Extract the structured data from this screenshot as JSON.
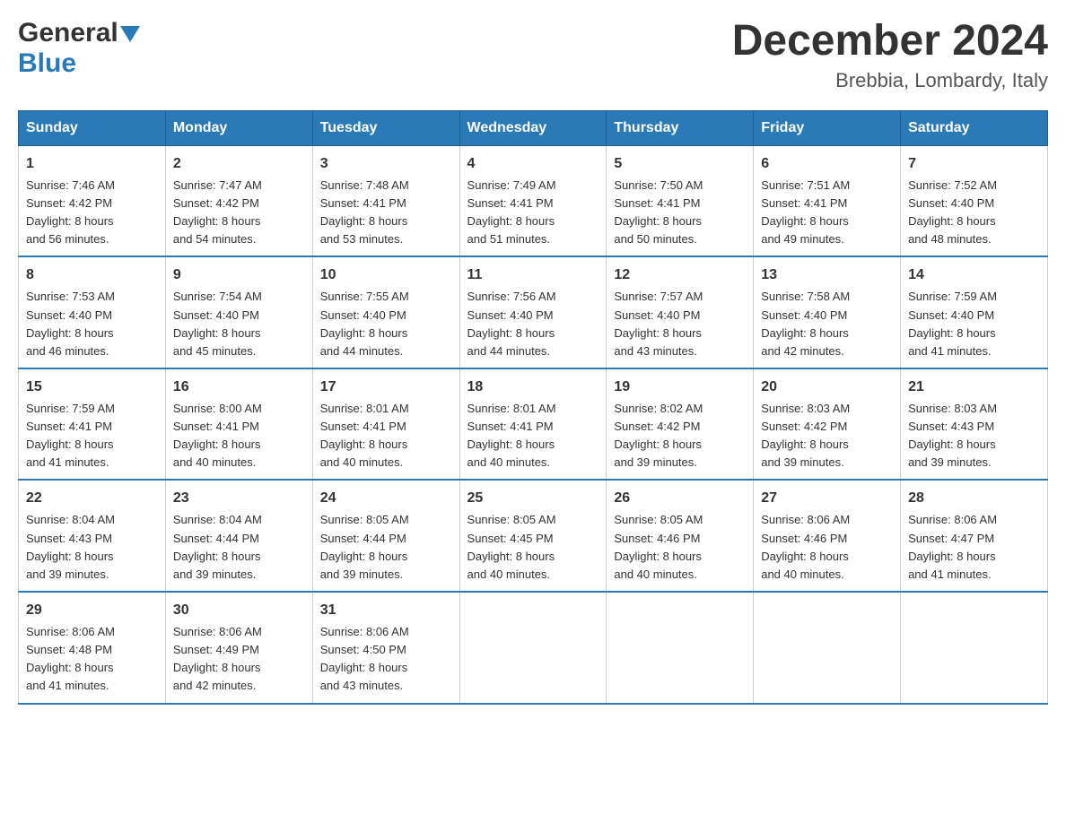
{
  "logo": {
    "general": "General",
    "blue": "Blue",
    "triangle": "▼"
  },
  "title": {
    "month_year": "December 2024",
    "location": "Brebbia, Lombardy, Italy"
  },
  "headers": [
    "Sunday",
    "Monday",
    "Tuesday",
    "Wednesday",
    "Thursday",
    "Friday",
    "Saturday"
  ],
  "weeks": [
    [
      {
        "day": "1",
        "sunrise": "7:46 AM",
        "sunset": "4:42 PM",
        "daylight": "8 hours and 56 minutes."
      },
      {
        "day": "2",
        "sunrise": "7:47 AM",
        "sunset": "4:42 PM",
        "daylight": "8 hours and 54 minutes."
      },
      {
        "day": "3",
        "sunrise": "7:48 AM",
        "sunset": "4:41 PM",
        "daylight": "8 hours and 53 minutes."
      },
      {
        "day": "4",
        "sunrise": "7:49 AM",
        "sunset": "4:41 PM",
        "daylight": "8 hours and 51 minutes."
      },
      {
        "day": "5",
        "sunrise": "7:50 AM",
        "sunset": "4:41 PM",
        "daylight": "8 hours and 50 minutes."
      },
      {
        "day": "6",
        "sunrise": "7:51 AM",
        "sunset": "4:41 PM",
        "daylight": "8 hours and 49 minutes."
      },
      {
        "day": "7",
        "sunrise": "7:52 AM",
        "sunset": "4:40 PM",
        "daylight": "8 hours and 48 minutes."
      }
    ],
    [
      {
        "day": "8",
        "sunrise": "7:53 AM",
        "sunset": "4:40 PM",
        "daylight": "8 hours and 46 minutes."
      },
      {
        "day": "9",
        "sunrise": "7:54 AM",
        "sunset": "4:40 PM",
        "daylight": "8 hours and 45 minutes."
      },
      {
        "day": "10",
        "sunrise": "7:55 AM",
        "sunset": "4:40 PM",
        "daylight": "8 hours and 44 minutes."
      },
      {
        "day": "11",
        "sunrise": "7:56 AM",
        "sunset": "4:40 PM",
        "daylight": "8 hours and 44 minutes."
      },
      {
        "day": "12",
        "sunrise": "7:57 AM",
        "sunset": "4:40 PM",
        "daylight": "8 hours and 43 minutes."
      },
      {
        "day": "13",
        "sunrise": "7:58 AM",
        "sunset": "4:40 PM",
        "daylight": "8 hours and 42 minutes."
      },
      {
        "day": "14",
        "sunrise": "7:59 AM",
        "sunset": "4:40 PM",
        "daylight": "8 hours and 41 minutes."
      }
    ],
    [
      {
        "day": "15",
        "sunrise": "7:59 AM",
        "sunset": "4:41 PM",
        "daylight": "8 hours and 41 minutes."
      },
      {
        "day": "16",
        "sunrise": "8:00 AM",
        "sunset": "4:41 PM",
        "daylight": "8 hours and 40 minutes."
      },
      {
        "day": "17",
        "sunrise": "8:01 AM",
        "sunset": "4:41 PM",
        "daylight": "8 hours and 40 minutes."
      },
      {
        "day": "18",
        "sunrise": "8:01 AM",
        "sunset": "4:41 PM",
        "daylight": "8 hours and 40 minutes."
      },
      {
        "day": "19",
        "sunrise": "8:02 AM",
        "sunset": "4:42 PM",
        "daylight": "8 hours and 39 minutes."
      },
      {
        "day": "20",
        "sunrise": "8:03 AM",
        "sunset": "4:42 PM",
        "daylight": "8 hours and 39 minutes."
      },
      {
        "day": "21",
        "sunrise": "8:03 AM",
        "sunset": "4:43 PM",
        "daylight": "8 hours and 39 minutes."
      }
    ],
    [
      {
        "day": "22",
        "sunrise": "8:04 AM",
        "sunset": "4:43 PM",
        "daylight": "8 hours and 39 minutes."
      },
      {
        "day": "23",
        "sunrise": "8:04 AM",
        "sunset": "4:44 PM",
        "daylight": "8 hours and 39 minutes."
      },
      {
        "day": "24",
        "sunrise": "8:05 AM",
        "sunset": "4:44 PM",
        "daylight": "8 hours and 39 minutes."
      },
      {
        "day": "25",
        "sunrise": "8:05 AM",
        "sunset": "4:45 PM",
        "daylight": "8 hours and 40 minutes."
      },
      {
        "day": "26",
        "sunrise": "8:05 AM",
        "sunset": "4:46 PM",
        "daylight": "8 hours and 40 minutes."
      },
      {
        "day": "27",
        "sunrise": "8:06 AM",
        "sunset": "4:46 PM",
        "daylight": "8 hours and 40 minutes."
      },
      {
        "day": "28",
        "sunrise": "8:06 AM",
        "sunset": "4:47 PM",
        "daylight": "8 hours and 41 minutes."
      }
    ],
    [
      {
        "day": "29",
        "sunrise": "8:06 AM",
        "sunset": "4:48 PM",
        "daylight": "8 hours and 41 minutes."
      },
      {
        "day": "30",
        "sunrise": "8:06 AM",
        "sunset": "4:49 PM",
        "daylight": "8 hours and 42 minutes."
      },
      {
        "day": "31",
        "sunrise": "8:06 AM",
        "sunset": "4:50 PM",
        "daylight": "8 hours and 43 minutes."
      },
      null,
      null,
      null,
      null
    ]
  ],
  "labels": {
    "sunrise": "Sunrise:",
    "sunset": "Sunset:",
    "daylight": "Daylight:"
  }
}
